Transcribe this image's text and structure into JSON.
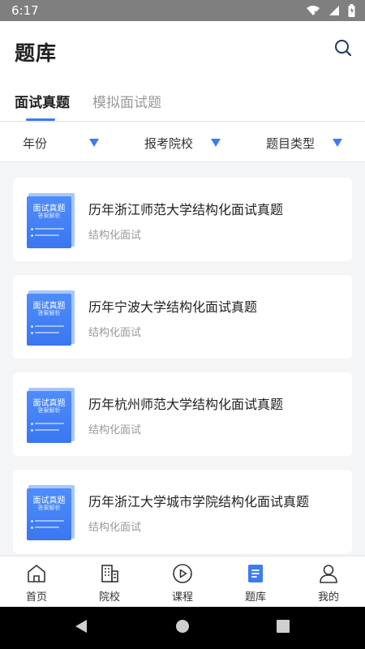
{
  "status_bar": {
    "time": "6:17"
  },
  "header": {
    "title": "题库"
  },
  "tabs": [
    {
      "label": "面试真题",
      "active": true
    },
    {
      "label": "模拟面试题",
      "active": false
    }
  ],
  "filters": [
    {
      "label": "年份"
    },
    {
      "label": "报考院校"
    },
    {
      "label": "题目类型"
    }
  ],
  "items": [
    {
      "cover_title": "面试真题",
      "cover_sub": "答案解析",
      "title": "历年浙江师范大学结构化面试真题",
      "subtitle": "结构化面试"
    },
    {
      "cover_title": "面试真题",
      "cover_sub": "答案解析",
      "title": "历年宁波大学结构化面试真题",
      "subtitle": "结构化面试"
    },
    {
      "cover_title": "面试真题",
      "cover_sub": "答案解析",
      "title": "历年杭州师范大学结构化面试真题",
      "subtitle": "结构化面试"
    },
    {
      "cover_title": "面试真题",
      "cover_sub": "答案解析",
      "title": "历年浙江大学城市学院结构化面试真题",
      "subtitle": "结构化面试"
    }
  ],
  "bottom_nav": [
    {
      "label": "首页",
      "icon": "home-icon",
      "active": false
    },
    {
      "label": "院校",
      "icon": "building-icon",
      "active": false
    },
    {
      "label": "课程",
      "icon": "play-circle-icon",
      "active": false
    },
    {
      "label": "题库",
      "icon": "question-bank-icon",
      "active": true
    },
    {
      "label": "我的",
      "icon": "user-icon",
      "active": false
    }
  ],
  "colors": {
    "accent": "#3b7cf5",
    "text": "#222222",
    "muted": "#999999",
    "background": "#f4f5f7"
  }
}
